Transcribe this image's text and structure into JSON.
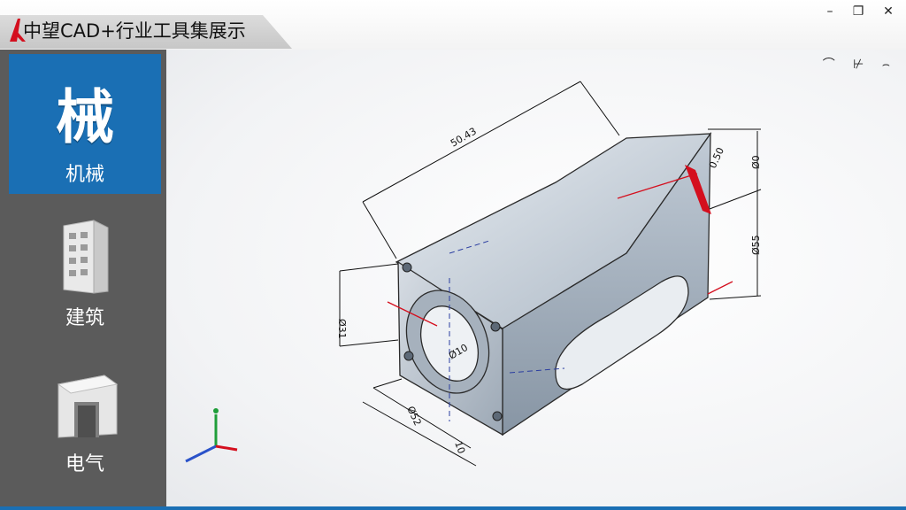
{
  "window": {
    "title": "中望CAD+行业工具集展示",
    "controls": {
      "minimize": "–",
      "maximize": "❐",
      "close": "✕"
    }
  },
  "sidebar": {
    "items": [
      {
        "label": "机械",
        "glyph": "械",
        "icon": "machinery-glyph-icon",
        "active": true
      },
      {
        "label": "建筑",
        "icon": "building-icon",
        "active": false
      },
      {
        "label": "电气",
        "icon": "electrical-icon",
        "active": false
      }
    ]
  },
  "viewport": {
    "tool_icons": "⌒ ⊬ ⌢",
    "dimensions": [
      "50.43",
      "0.50",
      "Ø0",
      "Ø55",
      "Ø31",
      "Ø52",
      "10",
      "Ø10"
    ]
  },
  "colors": {
    "accent": "#1a6fb4",
    "sidebar": "#5b5b5b",
    "part": "#9aa8b7",
    "dimension-red": "#d40f1e"
  }
}
